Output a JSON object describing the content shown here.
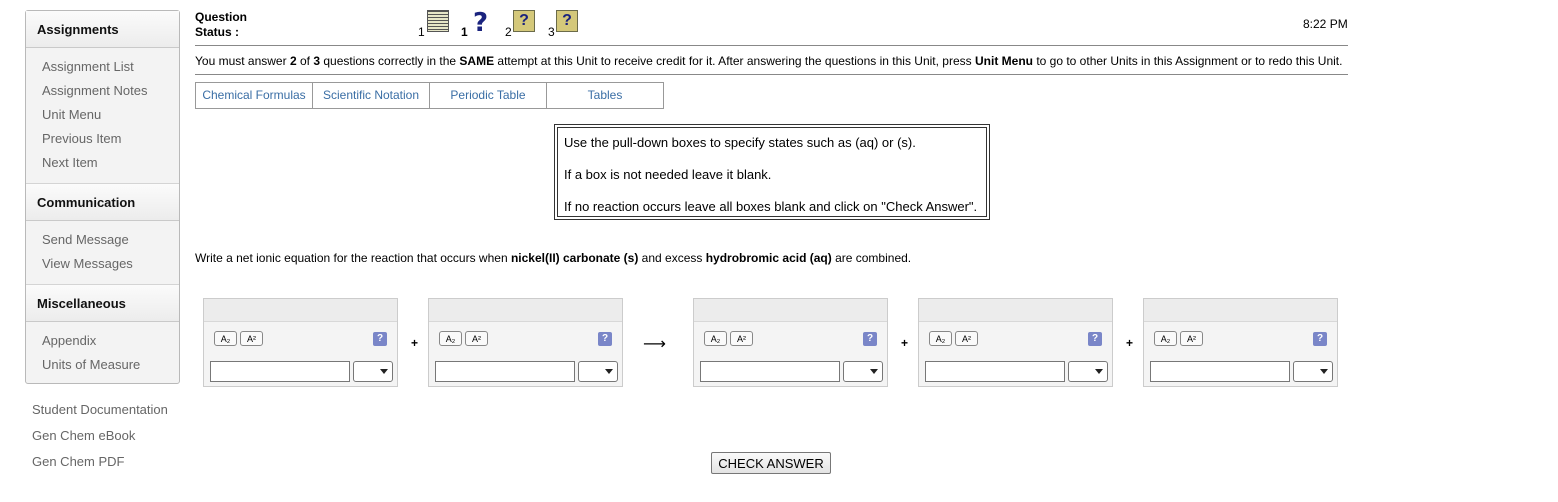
{
  "sidebar": {
    "sections": [
      {
        "title": "Assignments",
        "items": [
          "Assignment List",
          "Assignment Notes",
          "Unit Menu",
          "Previous Item",
          "Next Item"
        ]
      },
      {
        "title": "Communication",
        "items": [
          "Send Message",
          "View Messages"
        ]
      },
      {
        "title": "Miscellaneous",
        "items": [
          "Appendix",
          "Units of Measure"
        ]
      }
    ],
    "extra_links": [
      "Student Documentation",
      "Gen Chem eBook",
      "Gen Chem PDF"
    ]
  },
  "status": {
    "label_line1": "Question",
    "label_line2": "Status :",
    "icons": [
      {
        "num": "1",
        "icon": "list-icon"
      },
      {
        "num": "1",
        "icon": "question-mark-icon"
      },
      {
        "num": "2",
        "icon": "help-icon"
      },
      {
        "num": "3",
        "icon": "help-icon"
      }
    ],
    "clock": "8:22 PM"
  },
  "notice": {
    "t1": "You must answer ",
    "b1": "2",
    "t2": " of ",
    "b2": "3",
    "t3": " questions correctly in the ",
    "b3": "SAME",
    "t4": " attempt at this Unit to receive credit for it. After answering the questions in this Unit, press ",
    "b4": "Unit Menu",
    "t5": " to go to other Units in this Assignment or to redo this Unit."
  },
  "tabs": [
    "Chemical Formulas",
    "Scientific Notation",
    "Periodic Table",
    "Tables"
  ],
  "instructions": [
    "Use the pull-down boxes to specify states such as (aq) or (s).",
    "If a box is not needed leave it blank.",
    "If no reaction occurs leave all boxes blank and click on \"Check Answer\"."
  ],
  "prompt": {
    "t1": "Write a net ionic equation for the reaction that occurs when ",
    "b1": "nickel(II) carbonate (s)",
    "t2": " and excess ",
    "b2": "hydrobromic acid (aq)",
    "t3": " are combined."
  },
  "equation": {
    "subscript_label": "A₂",
    "superscript_label": "A²",
    "help_label": "?",
    "plus": "+",
    "arrow": "⟶",
    "formula_value": "",
    "state_value": ""
  },
  "check_button": "CHECK ANSWER",
  "colors": {
    "link": "#3a6ea5",
    "help_button": "#7a86c8",
    "sidebar_bg": "#f3f3f3"
  }
}
